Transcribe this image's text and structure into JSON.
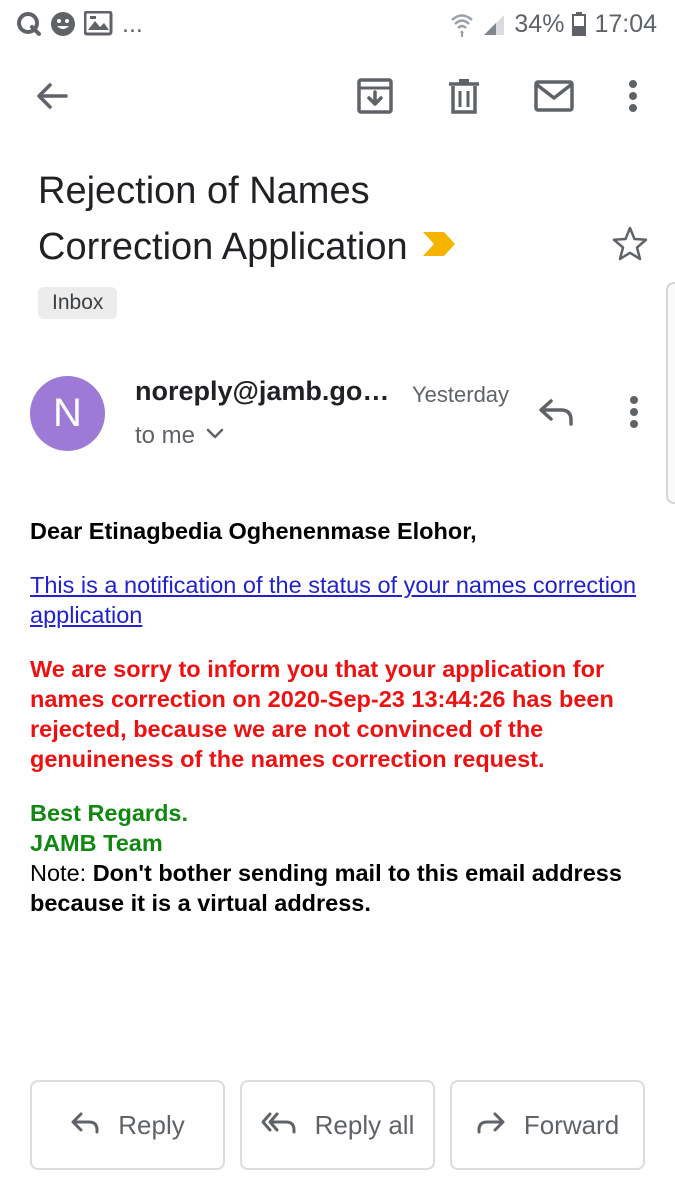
{
  "status_bar": {
    "overflow": "...",
    "battery": "34%",
    "time": "17:04",
    "left_icons": [
      "q-icon",
      "face-icon",
      "gallery-icon"
    ],
    "right_icons": [
      "wifi-icon",
      "signal-icon",
      "battery-icon"
    ]
  },
  "toolbar": {
    "icons": [
      "back-arrow-icon",
      "archive-icon",
      "delete-icon",
      "mark-unread-icon",
      "more-vert-icon"
    ]
  },
  "subject": {
    "line1": "Rejection of Names",
    "line2": "Correction Application",
    "important_color": "#f4b400",
    "label": "Inbox"
  },
  "sender": {
    "initial": "N",
    "avatar_color": "#9c7ad6",
    "name": "noreply@jamb.go…",
    "time": "Yesterday",
    "recipient": "to me"
  },
  "body": {
    "greeting": "Dear Etinagbedia Oghenenmase Elohor,",
    "link_text": "This is a notification of the status of your names correction application",
    "red_message": "We are sorry to inform you that your application for names correction on 2020-Sep-23 13:44:26 has been rejected, because we are not convinced of the genuineness of the names correction request.",
    "regards": "Best Regards.",
    "team": "JAMB Team",
    "note_label": "Note: ",
    "note_text": "Don't bother sending mail to this email address because it is a virtual address.",
    "colors": {
      "red": "#ee1111",
      "green": "#118811",
      "link": "#2222cc"
    }
  },
  "actions": {
    "reply": "Reply",
    "reply_all": "Reply all",
    "forward": "Forward"
  }
}
